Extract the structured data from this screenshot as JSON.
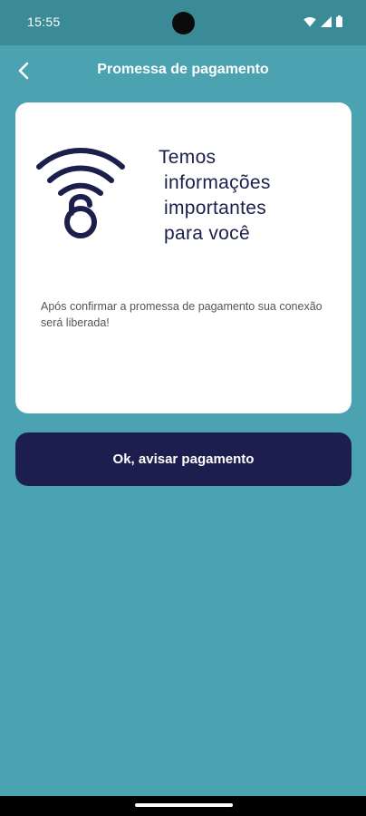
{
  "status_bar": {
    "time": "15:55",
    "icons": [
      "wifi-icon",
      "signal-icon",
      "battery-icon"
    ]
  },
  "app_bar": {
    "back_icon": "chevron-left-icon",
    "title": "Promessa de pagamento"
  },
  "card": {
    "icon": "wifi-lock-icon",
    "heading_lines": [
      "Temos",
      "informações",
      "importantes",
      "para você"
    ],
    "body_text": "Após confirmar a promessa de pagamento sua conexão será liberada!"
  },
  "confirm_button": {
    "label": "Ok, avisar pagamento"
  },
  "colors": {
    "background": "#4ba3b1",
    "status_bar": "#3a8a97",
    "primary_dark": "#1c1e4d",
    "card": "#ffffff"
  }
}
